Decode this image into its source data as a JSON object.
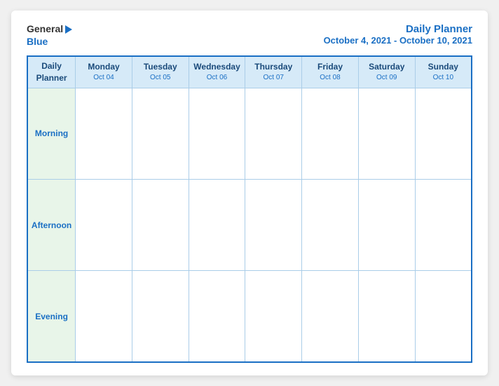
{
  "logo": {
    "general": "General",
    "blue": "Blue"
  },
  "header": {
    "title": "Daily Planner",
    "date_range": "October 4, 2021 - October 10, 2021"
  },
  "columns": [
    {
      "id": "label",
      "day": "Daily",
      "day2": "Planner",
      "date": ""
    },
    {
      "id": "mon",
      "day": "Monday",
      "date": "Oct 04"
    },
    {
      "id": "tue",
      "day": "Tuesday",
      "date": "Oct 05"
    },
    {
      "id": "wed",
      "day": "Wednesday",
      "date": "Oct 06"
    },
    {
      "id": "thu",
      "day": "Thursday",
      "date": "Oct 07"
    },
    {
      "id": "fri",
      "day": "Friday",
      "date": "Oct 08"
    },
    {
      "id": "sat",
      "day": "Saturday",
      "date": "Oct 09"
    },
    {
      "id": "sun",
      "day": "Sunday",
      "date": "Oct 10"
    }
  ],
  "rows": [
    {
      "id": "morning",
      "label": "Morning"
    },
    {
      "id": "afternoon",
      "label": "Afternoon"
    },
    {
      "id": "evening",
      "label": "Evening"
    }
  ]
}
